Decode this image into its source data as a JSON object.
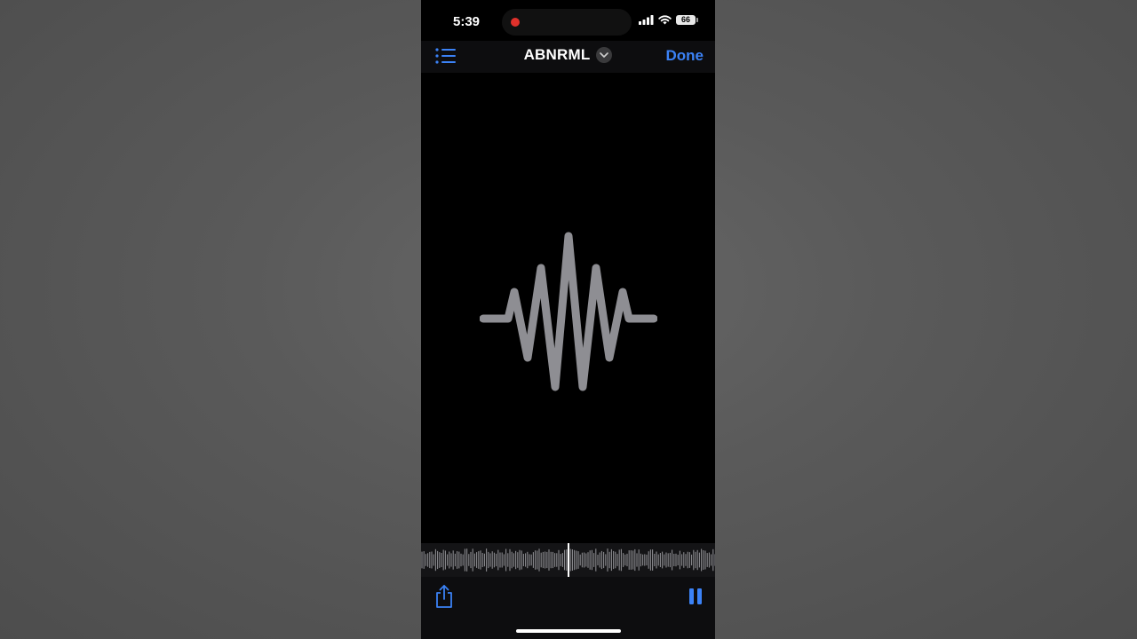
{
  "status_bar": {
    "time": "5:39",
    "battery": "66",
    "recording_indicator_color": "#e0312b",
    "icons": [
      "cellular-signal-icon",
      "wifi-icon",
      "battery-icon"
    ]
  },
  "nav": {
    "title": "ABNRML",
    "done_label": "Done",
    "list_icon": "list-icon",
    "chevron_icon": "chevron-down-icon",
    "accent_color": "#3b82f6"
  },
  "artwork": {
    "icon": "waveform-artwork-icon",
    "color": "#8e8e93"
  },
  "scrubber": {
    "icon": "audio-waveform-scrubber",
    "playhead_progress": 0.5
  },
  "bottom_bar": {
    "share_icon": "share-icon",
    "pause_icon": "pause-icon"
  }
}
